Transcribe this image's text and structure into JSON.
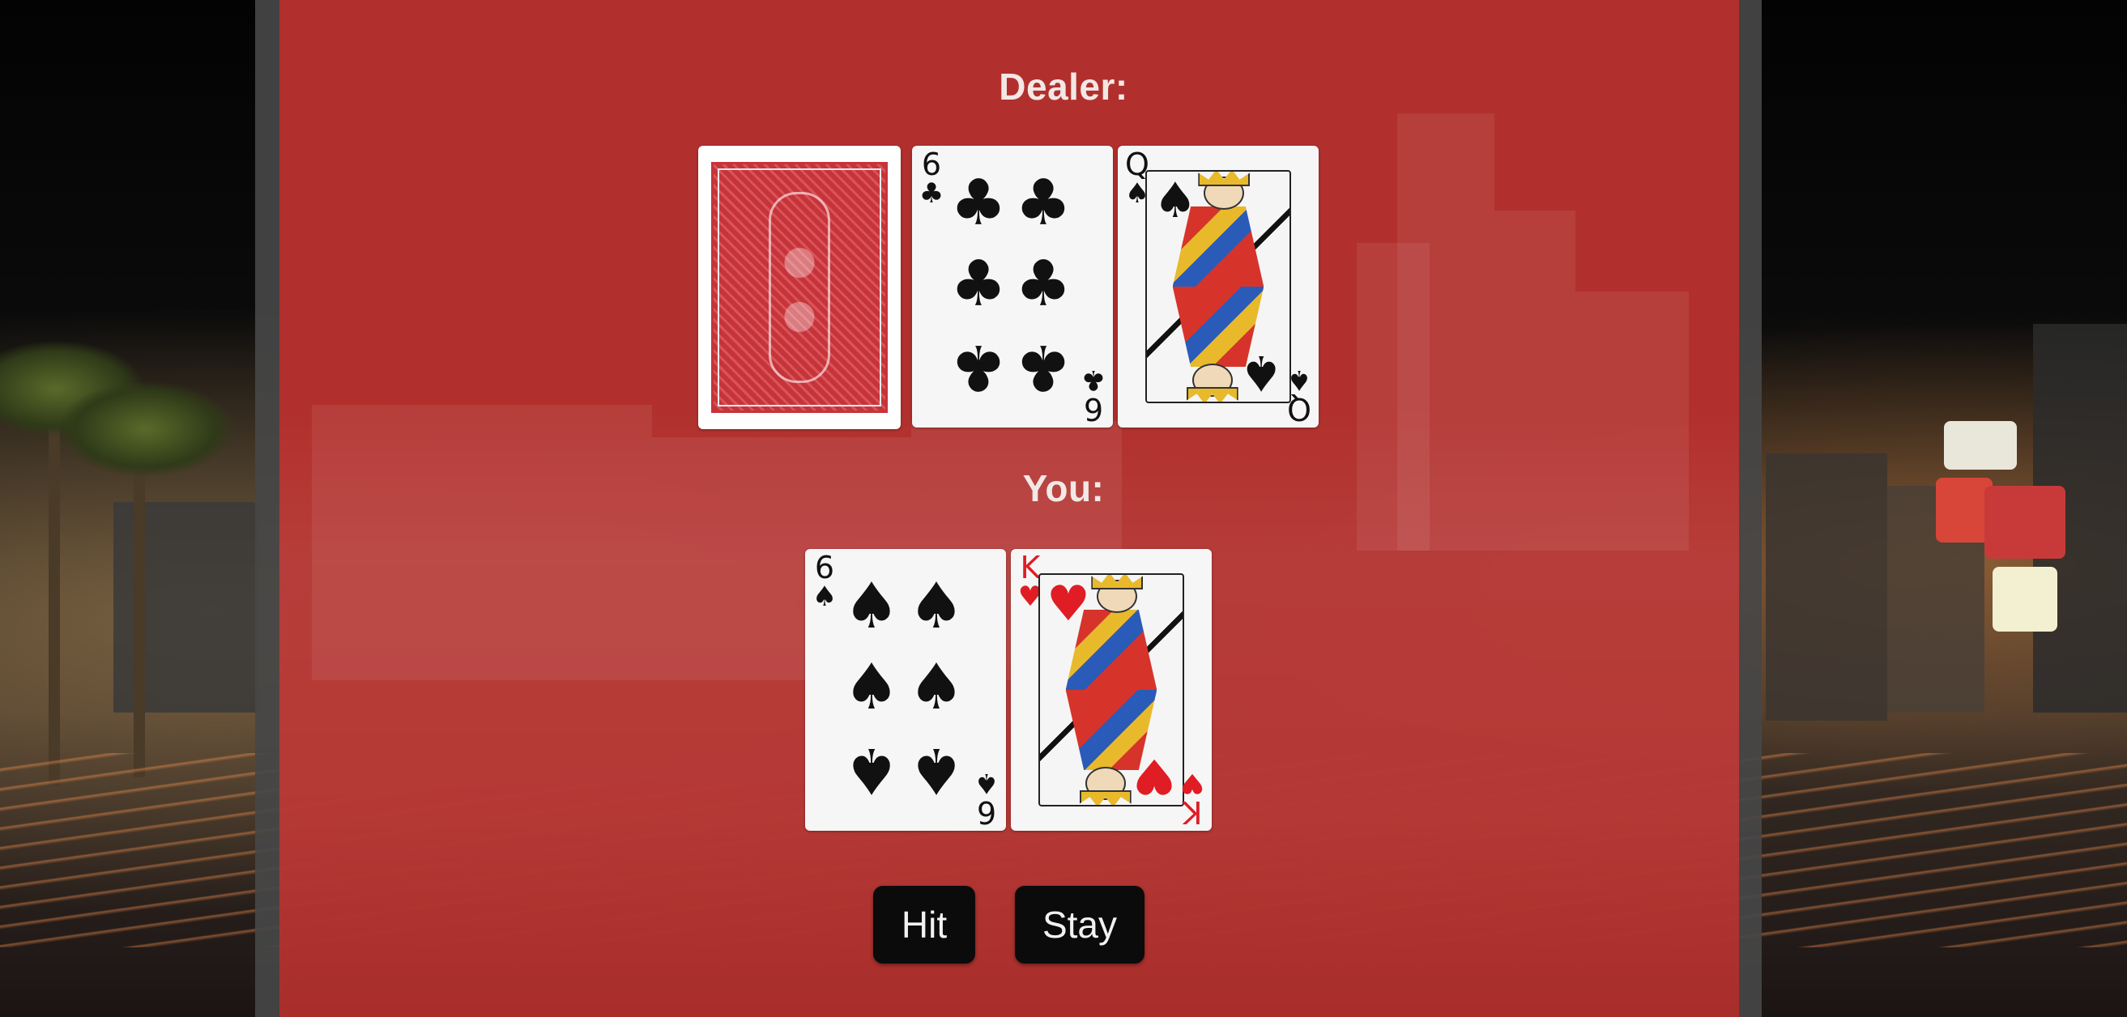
{
  "dealer": {
    "label": "Dealer:",
    "cards": [
      {
        "face_down": true
      },
      {
        "rank": "6",
        "suit": "♣",
        "suit_name": "clubs",
        "color": "black"
      },
      {
        "rank": "Q",
        "suit": "♠",
        "suit_name": "spades",
        "color": "black"
      }
    ]
  },
  "player": {
    "label": "You:",
    "cards": [
      {
        "rank": "6",
        "suit": "♠",
        "suit_name": "spades",
        "color": "black"
      },
      {
        "rank": "K",
        "suit": "♥",
        "suit_name": "hearts",
        "color": "red"
      }
    ]
  },
  "controls": {
    "hit_label": "Hit",
    "stay_label": "Stay"
  },
  "colors": {
    "panel": "#c42d2a",
    "button": "#0b0b0b",
    "card_red": "#e01c24",
    "card_black": "#111111"
  }
}
